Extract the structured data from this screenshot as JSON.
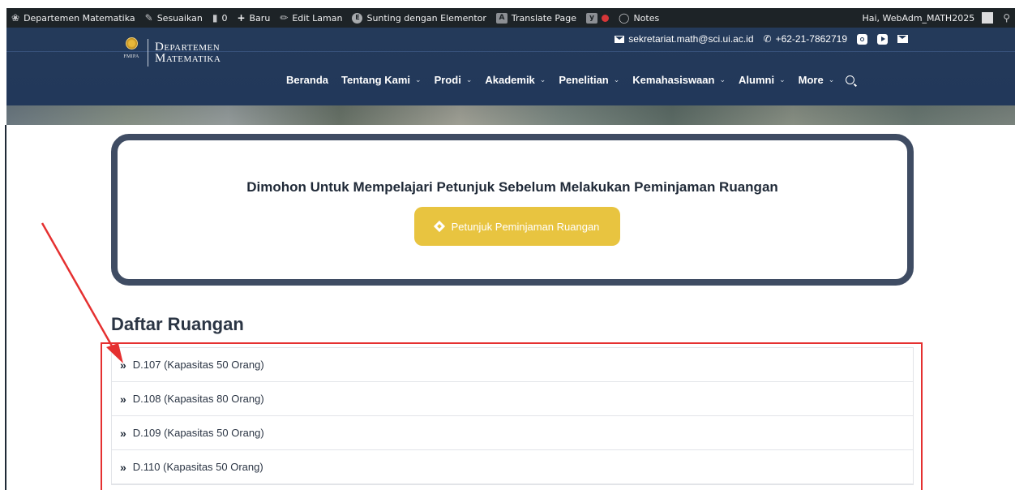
{
  "admin_bar": {
    "items": [
      {
        "label": "Departemen Matematika",
        "icon": "site-icon"
      },
      {
        "label": "Sesuaikan",
        "icon": "brush-icon"
      },
      {
        "label": "0",
        "icon": "comment-icon"
      },
      {
        "label": "Baru",
        "icon": "plus-icon"
      },
      {
        "label": "Edit Laman",
        "icon": "pencil-icon"
      },
      {
        "label": "Sunting dengan Elementor",
        "icon": "elementor-icon"
      },
      {
        "label": "Translate Page",
        "icon": "translate-icon"
      },
      {
        "label": "Notes",
        "icon": "notes-icon"
      }
    ],
    "greeting": "Hai, WebAdm_MATH2025"
  },
  "contact": {
    "email": "sekretariat.math@sci.ui.ac.id",
    "phone": "+62-21-7862719"
  },
  "logo": {
    "line1": "Departemen",
    "line2": "Matematika",
    "fmipa": "FMIPA"
  },
  "nav": {
    "items": [
      {
        "label": "Beranda",
        "dropdown": false
      },
      {
        "label": "Tentang Kami",
        "dropdown": true
      },
      {
        "label": "Prodi",
        "dropdown": true
      },
      {
        "label": "Akademik",
        "dropdown": true
      },
      {
        "label": "Penelitian",
        "dropdown": true
      },
      {
        "label": "Kemahasiswaan",
        "dropdown": true
      },
      {
        "label": "Alumni",
        "dropdown": true
      },
      {
        "label": "More",
        "dropdown": true
      }
    ]
  },
  "notice": {
    "title": "Dimohon Untuk Mempelajari Petunjuk Sebelum Melakukan Peminjaman Ruangan",
    "button_label": "Petunjuk Peminjaman Ruangan"
  },
  "rooms": {
    "heading": "Daftar Ruangan",
    "items": [
      "D.107 (Kapasitas 50 Orang)",
      "D.108 (Kapasitas 80 Orang)",
      "D.109 (Kapasitas 50 Orang)",
      "D.110 (Kapasitas 50 Orang)"
    ]
  },
  "colors": {
    "header_bg": "#243a5a",
    "adminbar_bg": "#1d2327",
    "button_yellow": "#e8c440",
    "notice_border": "#3f4c63",
    "annotation_red": "#e53030"
  }
}
